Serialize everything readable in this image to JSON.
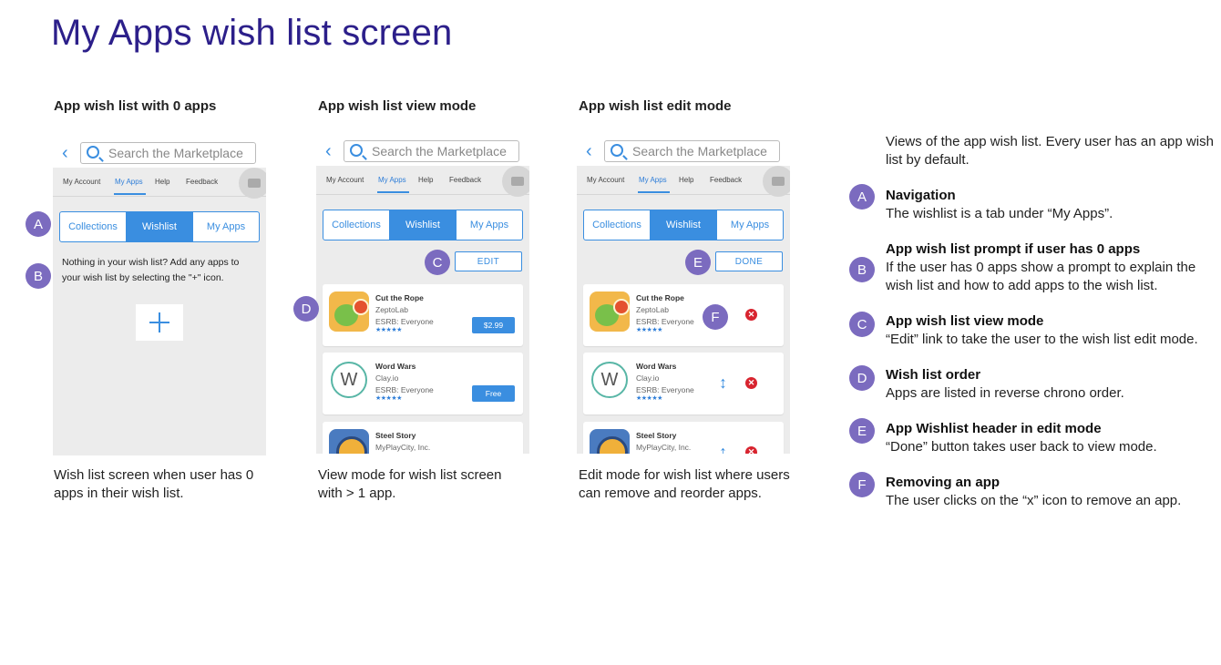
{
  "page_title": "My Apps wish list screen",
  "search_placeholder": "Search the Marketplace",
  "nav": [
    "My Account",
    "My Apps",
    "Help",
    "Feedback"
  ],
  "segments": [
    "Collections",
    "Wishlist",
    "My Apps"
  ],
  "columns": [
    {
      "heading": "App wish list with 0 apps",
      "caption": "Wish list screen when user has 0 apps  in their wish list.",
      "empty_message": "Nothing in your wish list? Add any apps to your wish list by selecting the \"+\" icon."
    },
    {
      "heading": "App wish list view mode",
      "caption": "View mode for wish list screen with > 1 app.",
      "button_label": "EDIT"
    },
    {
      "heading": "App wish list edit mode",
      "caption": "Edit mode for wish list where users can remove and reorder apps.",
      "button_label": "DONE"
    }
  ],
  "apps": [
    {
      "name": "Cut the Rope",
      "developer": "ZeptoLab",
      "rating_label": "ESRB: Everyone",
      "price": "$2.99",
      "stars": "★★★★★"
    },
    {
      "name": "Word Wars",
      "developer": "Clay.io",
      "rating_label": "ESRB: Everyone",
      "price": "Free",
      "stars": "★★★★★",
      "icon_letter": "W"
    },
    {
      "name": "Steel Story",
      "developer": "MyPlayCity, Inc."
    }
  ],
  "badges": [
    "A",
    "B",
    "C",
    "D",
    "E",
    "F"
  ],
  "icons": {
    "back": "chevron-left-icon",
    "search": "search-icon",
    "camera": "camera-icon",
    "plus": "plus-icon",
    "reorder": "reorder-arrows-icon",
    "remove": "remove-x-icon"
  },
  "glyphs": {
    "back": "‹",
    "reorder": "↕",
    "remove": "✕",
    "reorder_partial": "↑"
  },
  "colors": {
    "title": "#2c1f8a",
    "accent": "#3a8ee0",
    "badge": "#7b6bbf",
    "remove": "#d8242f"
  },
  "notes_intro": "Views of the app wish list. Every user has an app wish list by default.",
  "notes": [
    {
      "badge": "A",
      "title": "Navigation",
      "desc": "The wishlist is a tab under “My Apps”."
    },
    {
      "badge": "B",
      "title": "App wish list prompt if user has 0 apps",
      "desc": "If the user has 0 apps show a prompt to explain the wish list and how to add apps to the wish list."
    },
    {
      "badge": "C",
      "title": "App  wish list view mode",
      "desc": "“Edit” link to take the user to the wish list edit mode."
    },
    {
      "badge": "D",
      "title": "Wish list order",
      "desc": "Apps are listed in reverse chrono order."
    },
    {
      "badge": "E",
      "title": "App Wishlist header in edit mode",
      "desc": "“Done” button takes user back to view mode."
    },
    {
      "badge": "F",
      "title": "Removing an app",
      "desc": "The user clicks on the “x” icon to remove an app."
    }
  ]
}
